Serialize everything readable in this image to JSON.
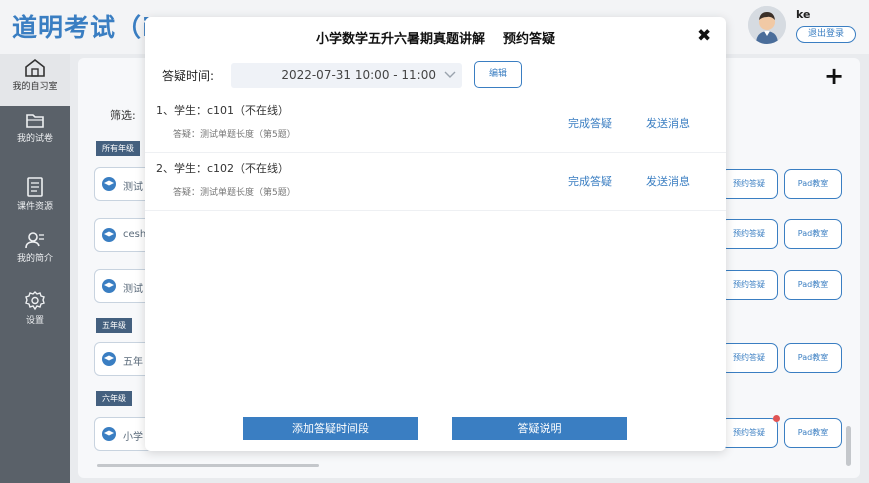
{
  "app": {
    "title": "道明考试（in"
  },
  "user": {
    "name": "ke",
    "logout_label": "退出登录"
  },
  "sidebar": {
    "items": [
      {
        "label": "我的自习室",
        "icon": "home-icon",
        "active": true
      },
      {
        "label": "我的试卷",
        "icon": "folder-icon"
      },
      {
        "label": "课件资源",
        "icon": "document-icon"
      },
      {
        "label": "我的简介",
        "icon": "profile-icon"
      },
      {
        "label": "设置",
        "icon": "gear-icon"
      }
    ]
  },
  "background": {
    "filter_label": "筛选:",
    "plus_icon": "plus-icon",
    "grades": [
      "所有年级",
      "五年级",
      "六年级"
    ],
    "courses": [
      "测试",
      "cesh",
      "测试",
      "五年",
      "小学"
    ],
    "action_buttons": {
      "reserve": "预约答疑",
      "pad": "Pad教室"
    }
  },
  "dialog": {
    "title": "小学数学五升六暑期真题讲解    预约答疑",
    "close_icon": "close-icon",
    "time_label": "答疑时间:",
    "time_value": "2022-07-31 10:00 - 11:00",
    "edit_label": "编辑",
    "rows": [
      {
        "student": "1、学生：c101（不在线）",
        "detail": "答疑：测试单题长度（第5题）",
        "complete": "完成答疑",
        "message": "发送消息"
      },
      {
        "student": "2、学生：c102（不在线）",
        "detail": "答疑：测试单题长度（第5题）",
        "complete": "完成答疑",
        "message": "发送消息"
      }
    ],
    "add_time_label": "添加答疑时间段",
    "explain_label": "答疑说明"
  },
  "colors": {
    "accent": "#3a7ec2",
    "sidebar": "#5a6169",
    "grade_tag": "#44607f",
    "notification_dot": "#e05454"
  }
}
